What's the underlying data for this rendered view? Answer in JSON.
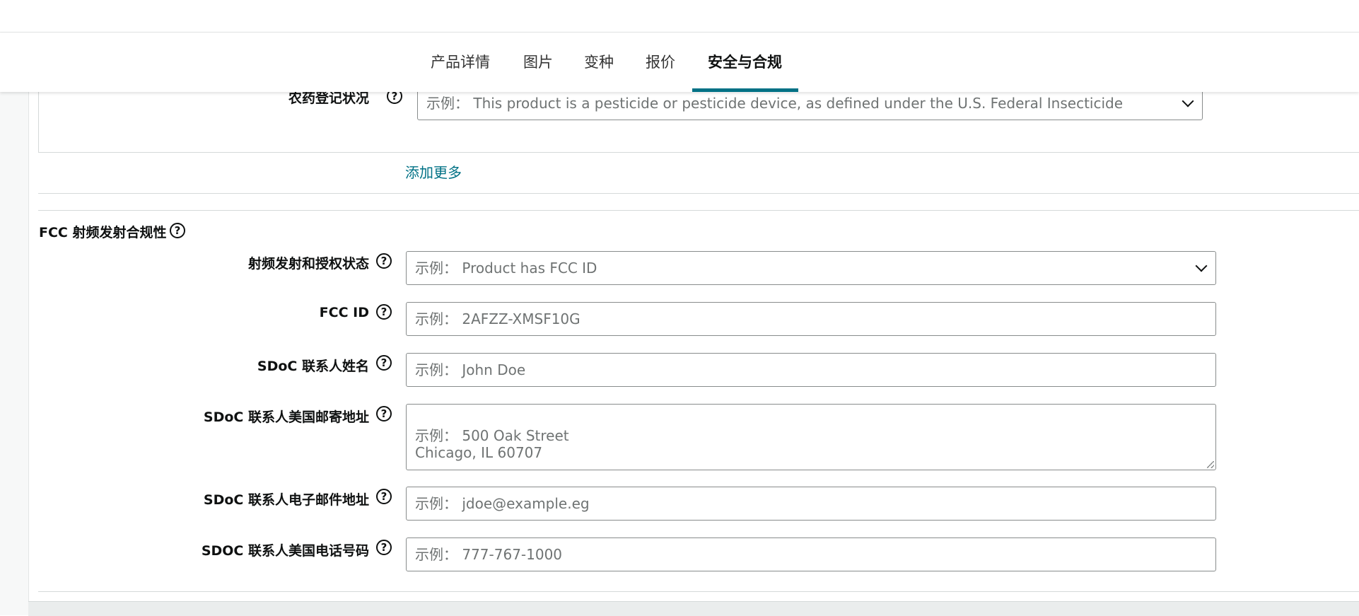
{
  "tabs": [
    {
      "label": "产品详情",
      "active": false
    },
    {
      "label": "图片",
      "active": false
    },
    {
      "label": "变种",
      "active": false
    },
    {
      "label": "报价",
      "active": false
    },
    {
      "label": "安全与合规",
      "active": true
    }
  ],
  "pesticide": {
    "label": "农药登记状况",
    "placeholder": "示例： This product is a pesticide or pesticide device, as defined under the U.S. Federal Insecticide"
  },
  "add_more_label": "添加更多",
  "fcc_section": {
    "title": "FCC 射频发射合规性",
    "fields": [
      {
        "label": "射频发射和授权状态",
        "placeholder": "示例： Product has FCC ID"
      },
      {
        "label": "FCC ID",
        "placeholder": "示例： 2AFZZ-XMSF10G"
      },
      {
        "label": "SDoC 联系人姓名",
        "placeholder": "示例： John Doe"
      },
      {
        "label": "SDoC 联系人美国邮寄地址",
        "placeholder": "示例： 500 Oak Street\nChicago, IL 60707"
      },
      {
        "label": "SDoC 联系人电子邮件地址",
        "placeholder": "示例： jdoe@example.eg"
      },
      {
        "label": "SDOC 联系人美国电话号码",
        "placeholder": "示例： 777-767-1000"
      }
    ]
  },
  "help_icon_glyph": "?",
  "colors": {
    "accent": "#007185",
    "border": "#888c8c",
    "placeholder_text": "#6f7373"
  }
}
